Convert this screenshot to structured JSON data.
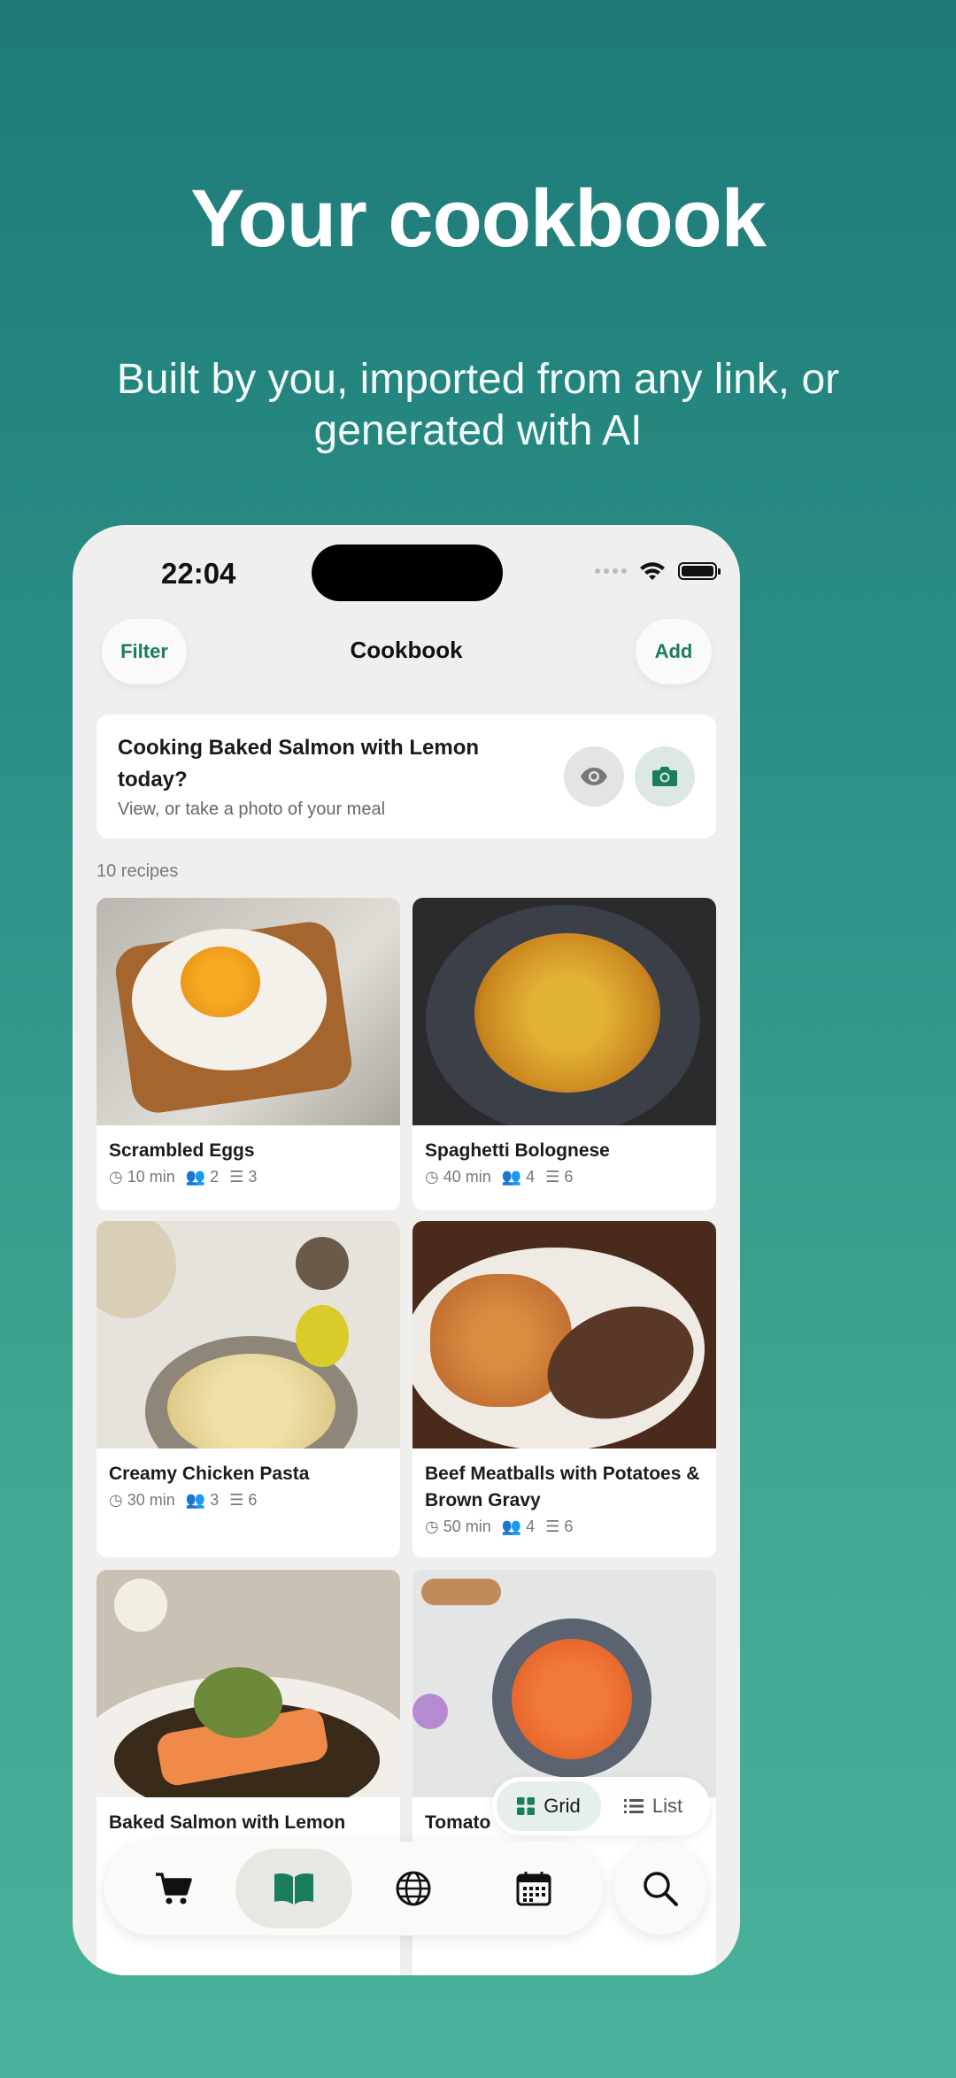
{
  "hero": {
    "title": "Your cookbook",
    "subtitle": "Built by you, imported from any link, or generated with AI"
  },
  "status_bar": {
    "time": "22:04"
  },
  "nav": {
    "left_button": "Filter",
    "title": "Cookbook",
    "right_button": "Add"
  },
  "banner": {
    "title": "Cooking Baked Salmon with Lemon today?",
    "subtitle": "View, or take a photo of your meal",
    "icons": [
      "eye-icon",
      "camera-icon"
    ]
  },
  "recipe_count": "10 recipes",
  "recipes": [
    {
      "title": "Scrambled Eggs",
      "time": "10 min",
      "servings": "2",
      "steps": "3"
    },
    {
      "title": "Spaghetti Bolognese",
      "time": "40 min",
      "servings": "4",
      "steps": "6"
    },
    {
      "title": "Creamy Chicken Pasta",
      "time": "30 min",
      "servings": "3",
      "steps": "6"
    },
    {
      "title": "Beef Meatballs with Potatoes & Brown Gravy",
      "time": "50 min",
      "servings": "4",
      "steps": "6"
    },
    {
      "title": "Baked Salmon with Lemon",
      "time": "",
      "servings": "",
      "steps": ""
    },
    {
      "title": "Tomato",
      "time": "",
      "servings": "",
      "steps": ""
    }
  ],
  "view_toggle": {
    "grid": "Grid",
    "list": "List",
    "selected": "Grid"
  },
  "tabbar": {
    "items": [
      "cart-icon",
      "book-icon",
      "globe-icon",
      "calendar-icon"
    ],
    "active": "book-icon",
    "search": "search-icon"
  },
  "colors": {
    "accent": "#1a7d5e",
    "background_top": "#1d7a78",
    "background_bottom": "#4ab29a"
  }
}
